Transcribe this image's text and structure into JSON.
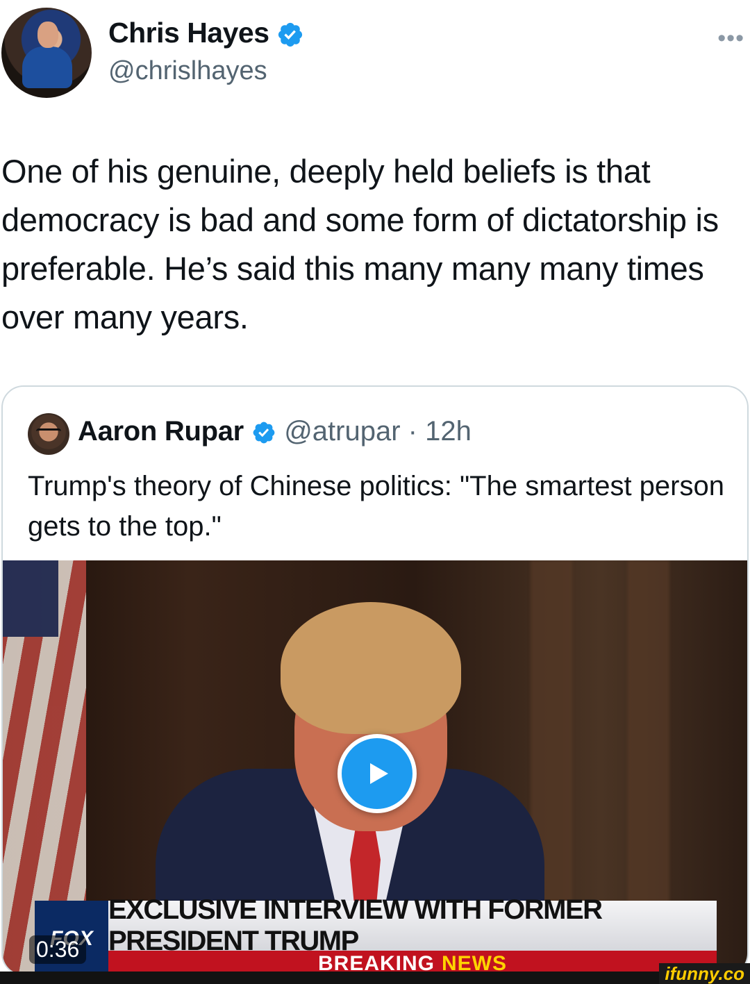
{
  "tweet": {
    "author_name": "Chris Hayes",
    "author_handle": "@chrislhayes",
    "text": "One of his genuine, deeply held beliefs is that democracy is bad and some form of dictatorship is preferable. He’s said this many many many times over many years.",
    "more_icon": "•••"
  },
  "quote": {
    "author_name": "Aaron Rupar",
    "author_handle": "@atrupar",
    "separator": "·",
    "time": "12h",
    "text": "Trump's theory of Chinese politics: \"The smartest person gets to the top.\"",
    "video": {
      "duration": "0:36",
      "chyron_main": "EXCLUSIVE INTERVIEW WITH FORMER PRESIDENT TRUMP",
      "chyron_sub_1": "BREAKING",
      "chyron_sub_2": "NEWS",
      "logo_text": "FOX"
    }
  },
  "watermark": "ifunny.co",
  "colors": {
    "verified_blue": "#1d9bf0",
    "secondary_text": "#536471",
    "border": "#cfd9de"
  },
  "icons": [
    "verified-badge-icon",
    "more-options-icon",
    "play-icon"
  ]
}
